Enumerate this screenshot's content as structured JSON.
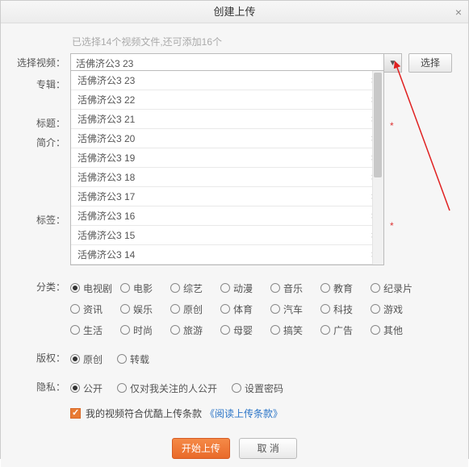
{
  "window": {
    "title": "创建上传",
    "close": "×"
  },
  "hint": "已选择14个视频文件,还可添加16个",
  "labels": {
    "select_video": "选择视频：",
    "album": "专辑：",
    "title": "标题：",
    "intro": "简介：",
    "tags": "标签：",
    "category": "分类：",
    "copyright": "版权：",
    "privacy": "隐私："
  },
  "combo": {
    "value": "活佛济公3 23",
    "choose_btn": "选择"
  },
  "dropdown": {
    "items": [
      "活佛济公3 23",
      "活佛济公3 22",
      "活佛济公3 21",
      "活佛济公3 20",
      "活佛济公3 19",
      "活佛济公3 18",
      "活佛济公3 17",
      "活佛济公3 16",
      "活佛济公3 15",
      "活佛济公3 14"
    ]
  },
  "categories": [
    "电视剧",
    "电影",
    "综艺",
    "动漫",
    "音乐",
    "教育",
    "纪录片",
    "资讯",
    "娱乐",
    "原创",
    "体育",
    "汽车",
    "科技",
    "游戏",
    "生活",
    "时尚",
    "旅游",
    "母婴",
    "搞笑",
    "广告",
    "其他"
  ],
  "category_selected": "电视剧",
  "copyright": {
    "options": [
      "原创",
      "转载"
    ],
    "selected": "原创"
  },
  "privacy": {
    "options": [
      "公开",
      "仅对我关注的人公开",
      "设置密码"
    ],
    "selected": "公开"
  },
  "agree": {
    "checked": true,
    "text": "我的视频符合优酷上传条款",
    "link": "《阅读上传条款》"
  },
  "footer": {
    "start": "开始上传",
    "cancel": "取 消"
  },
  "asterisk": "*",
  "arrow_color": "#e02020"
}
